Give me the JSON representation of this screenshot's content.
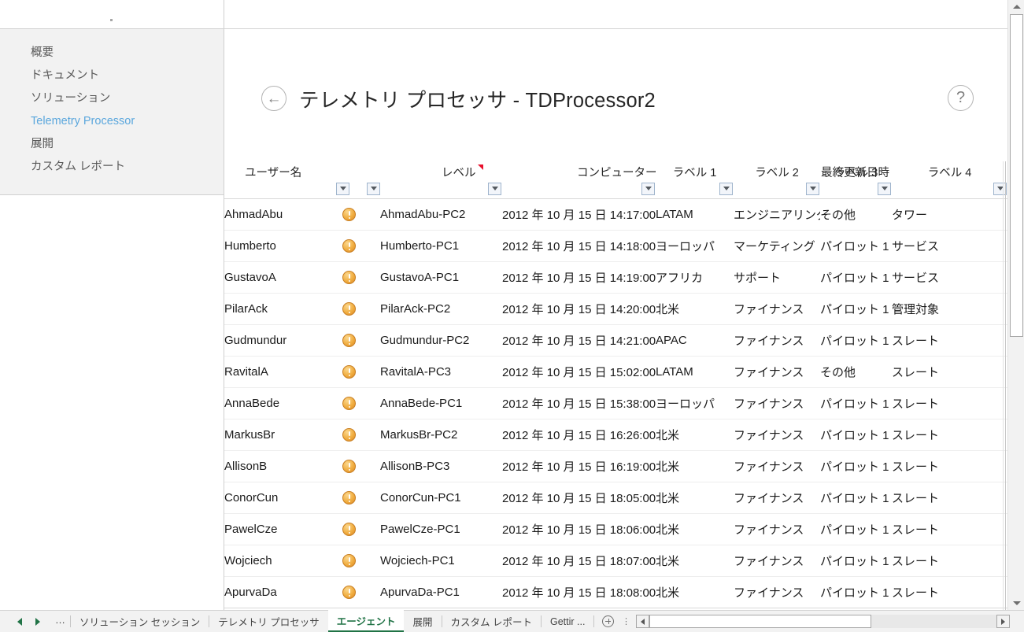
{
  "window": {
    "accent_color": "#217346",
    "selected_cell_color": "#1d6f42"
  },
  "nav_panel": {
    "items": [
      {
        "label": "概要",
        "active": false
      },
      {
        "label": "ドキュメント",
        "active": false
      },
      {
        "label": "ソリューション",
        "active": false
      },
      {
        "label": "Telemetry Processor",
        "active": true
      },
      {
        "label": "展開",
        "active": false
      },
      {
        "label": "カスタム レポート",
        "active": false
      }
    ],
    "active_color": "#5ba7dd"
  },
  "report": {
    "back_icon": "arrow-left-icon",
    "back_glyph": "←",
    "title": "テレメトリ プロセッサ - TDProcessor2",
    "help_icon": "help-icon",
    "help_glyph": "?"
  },
  "table": {
    "columns": [
      {
        "label": "ユーザー名",
        "key": "user",
        "align": "left",
        "has_filter": false,
        "has_comment": false
      },
      {
        "label": "レベル",
        "key": "level",
        "align": "left",
        "has_filter": true,
        "has_comment": true
      },
      {
        "label": "コンピューター",
        "key": "computer",
        "align": "center",
        "has_filter": true,
        "has_comment": false
      },
      {
        "label": "最終更新日時",
        "key": "updated",
        "align": "center",
        "has_filter": true,
        "has_comment": false
      },
      {
        "label": "ラベル 1",
        "key": "label1",
        "align": "center",
        "has_filter": true,
        "has_comment": false
      },
      {
        "label": "ラベル 2",
        "key": "label2",
        "align": "center",
        "has_filter": true,
        "has_comment": false
      },
      {
        "label": "ラベル 3",
        "key": "label3",
        "align": "center",
        "has_filter": true,
        "has_comment": false
      },
      {
        "label": "ラベル 4",
        "key": "label4",
        "align": "center",
        "has_filter": true,
        "has_comment": false
      }
    ],
    "level_icon": "warning-icon",
    "rows": [
      {
        "user": "AhmadAbu",
        "level": "warning",
        "computer": "AhmadAbu-PC2",
        "updated": "2012 年 10 月 15 日 14:17:00",
        "label1": "LATAM",
        "label2": "エンジニアリング",
        "label3": "その他",
        "label4": "タワー"
      },
      {
        "user": "Humberto",
        "level": "warning",
        "computer": "Humberto-PC1",
        "updated": "2012 年 10 月 15 日 14:18:00",
        "label1": "ヨーロッパ",
        "label2": "マーケティング",
        "label3": "パイロット 1",
        "label4": "サービス"
      },
      {
        "user": "GustavoA",
        "level": "warning",
        "computer": "GustavoA-PC1",
        "updated": "2012 年 10 月 15 日 14:19:00",
        "label1": "アフリカ",
        "label2": "サポート",
        "label3": "パイロット 1",
        "label4": "サービス"
      },
      {
        "user": "PilarAck",
        "level": "warning",
        "computer": "PilarAck-PC2",
        "updated": "2012 年 10 月 15 日 14:20:00",
        "label1": "北米",
        "label2": "ファイナンス",
        "label3": "パイロット 1",
        "label4": "管理対象"
      },
      {
        "user": "Gudmundur",
        "level": "warning",
        "computer": "Gudmundur-PC2",
        "updated": "2012 年 10 月 15 日 14:21:00",
        "label1": "APAC",
        "label2": "ファイナンス",
        "label3": "パイロット 1",
        "label4": "スレート"
      },
      {
        "user": "RavitalA",
        "level": "warning",
        "computer": "RavitalA-PC3",
        "updated": "2012 年 10 月 15 日 15:02:00",
        "label1": "LATAM",
        "label2": "ファイナンス",
        "label3": "その他",
        "label4": "スレート"
      },
      {
        "user": "AnnaBede",
        "level": "warning",
        "computer": "AnnaBede-PC1",
        "updated": "2012 年 10 月 15 日 15:38:00",
        "label1": "ヨーロッパ",
        "label2": "ファイナンス",
        "label3": "パイロット 1",
        "label4": "スレート"
      },
      {
        "user": "MarkusBr",
        "level": "warning",
        "computer": "MarkusBr-PC2",
        "updated": "2012 年 10 月 15 日 16:26:00",
        "label1": "北米",
        "label2": "ファイナンス",
        "label3": "パイロット 1",
        "label4": "スレート"
      },
      {
        "user": "AllisonB",
        "level": "warning",
        "computer": "AllisonB-PC3",
        "updated": "2012 年 10 月 15 日 16:19:00",
        "label1": "北米",
        "label2": "ファイナンス",
        "label3": "パイロット 1",
        "label4": "スレート"
      },
      {
        "user": "ConorCun",
        "level": "warning",
        "computer": "ConorCun-PC1",
        "updated": "2012 年 10 月 15 日 18:05:00",
        "label1": "北米",
        "label2": "ファイナンス",
        "label3": "パイロット 1",
        "label4": "スレート"
      },
      {
        "user": "PawelCze",
        "level": "warning",
        "computer": "PawelCze-PC1",
        "updated": "2012 年 10 月 15 日 18:06:00",
        "label1": "北米",
        "label2": "ファイナンス",
        "label3": "パイロット 1",
        "label4": "スレート"
      },
      {
        "user": "Wojciech",
        "level": "warning",
        "computer": "Wojciech-PC1",
        "updated": "2012 年 10 月 15 日 18:07:00",
        "label1": "北米",
        "label2": "ファイナンス",
        "label3": "パイロット 1",
        "label4": "スレート"
      },
      {
        "user": "ApurvaDa",
        "level": "warning",
        "computer": "ApurvaDa-PC1",
        "updated": "2012 年 10 月 15 日 18:08:00",
        "label1": "北米",
        "label2": "ファイナンス",
        "label3": "パイロット 1",
        "label4": "スレート"
      }
    ]
  },
  "sheet_tabs": {
    "prev_icon": "triangle-left-icon",
    "next_icon": "triangle-right-icon",
    "more_label": "…",
    "tabs": [
      {
        "label": "ソリューション セッション",
        "active": false
      },
      {
        "label": "テレメトリ プロセッサ",
        "active": false
      },
      {
        "label": "エージェント",
        "active": true
      },
      {
        "label": "展開",
        "active": false
      },
      {
        "label": "カスタム レポート",
        "active": false
      },
      {
        "label": "Gettir ...",
        "active": false
      }
    ],
    "add_icon": "add-sheet-icon",
    "overflow_icon": "vertical-dots-icon",
    "overflow_label": "⋮"
  },
  "scrollbars": {
    "vertical": {
      "up_icon": "scroll-up-icon",
      "down_icon": "scroll-down-icon"
    },
    "horizontal": {
      "left_icon": "scroll-left-icon",
      "right_icon": "scroll-right-icon"
    }
  }
}
